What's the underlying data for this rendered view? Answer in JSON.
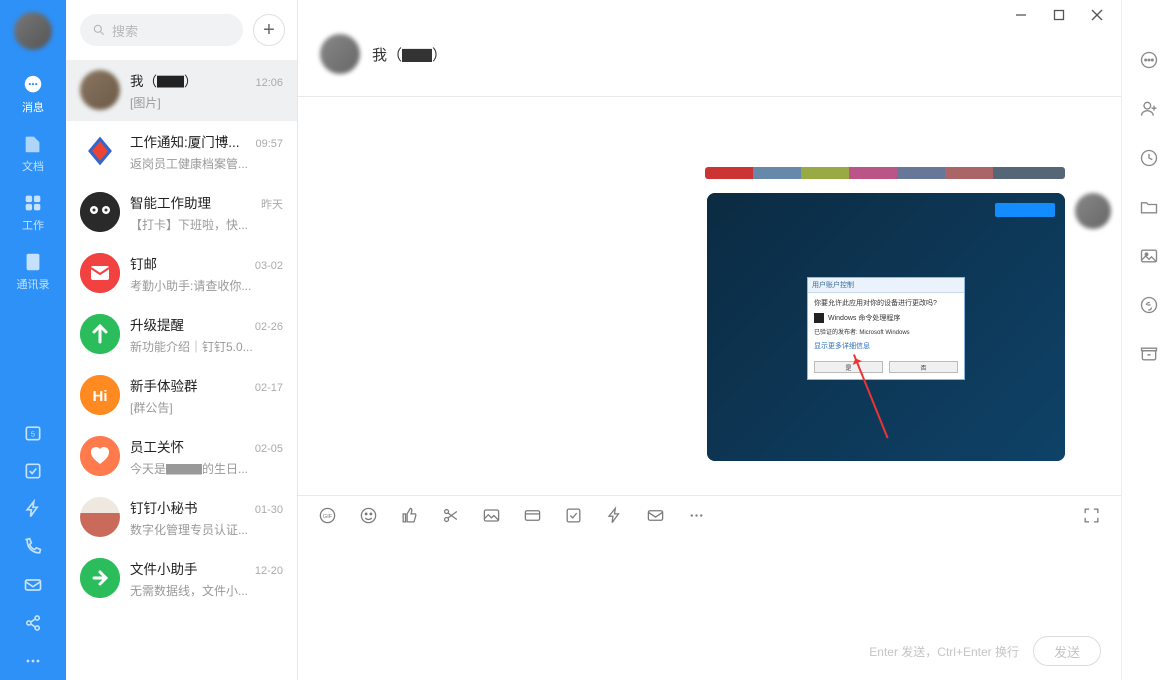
{
  "rail": {
    "items": [
      {
        "key": "messages",
        "label": "消息",
        "active": true
      },
      {
        "key": "docs",
        "label": "文档"
      },
      {
        "key": "work",
        "label": "工作"
      },
      {
        "key": "contacts",
        "label": "通讯录"
      }
    ]
  },
  "search": {
    "placeholder": "搜索"
  },
  "chat_header": {
    "title": "我（▇▇）"
  },
  "conversations": [
    {
      "title": "我（▇▇）",
      "subtitle": "[图片]",
      "time": "12:06",
      "active": true,
      "avatar": "av-blur"
    },
    {
      "title": "工作通知:厦门博...",
      "subtitle": "返岗员工健康档案管...",
      "time": "09:57",
      "avatar": "av-red-diamond"
    },
    {
      "title": "智能工作助理",
      "subtitle": "【打卡】下班啦，快...",
      "time": "昨天",
      "avatar": "av-black"
    },
    {
      "title": "钉邮",
      "subtitle": "考勤小助手:请查收你...",
      "time": "03-02",
      "avatar": "av-red"
    },
    {
      "title": "升级提醒",
      "subtitle": "新功能介绍｜钉钉5.0...",
      "time": "02-26",
      "avatar": "av-green"
    },
    {
      "title": "新手体验群",
      "subtitle": "[群公告]",
      "time": "02-17",
      "avatar": "av-orange",
      "badge": "Hi"
    },
    {
      "title": "员工关怀",
      "subtitle": "今天是▇▇▇的生日...",
      "time": "02-05",
      "avatar": "av-pink"
    },
    {
      "title": "钉钉小秘书",
      "subtitle": "数字化管理专员认证...",
      "time": "01-30",
      "avatar": "av-photo"
    },
    {
      "title": "文件小助手",
      "subtitle": "无需数据线，文件小...",
      "time": "12-20",
      "avatar": "av-green2"
    }
  ],
  "screenshot_dialog": {
    "title": "用户账户控制",
    "question": "你要允许此应用对你的设备进行更改吗?",
    "app": "Windows 命令处理程序",
    "publisher": "已验证的发布者: Microsoft Windows",
    "link": "显示更多详细信息",
    "yes": "是",
    "no": "否"
  },
  "input": {
    "hint": "Enter 发送，Ctrl+Enter 换行",
    "send": "发送"
  }
}
